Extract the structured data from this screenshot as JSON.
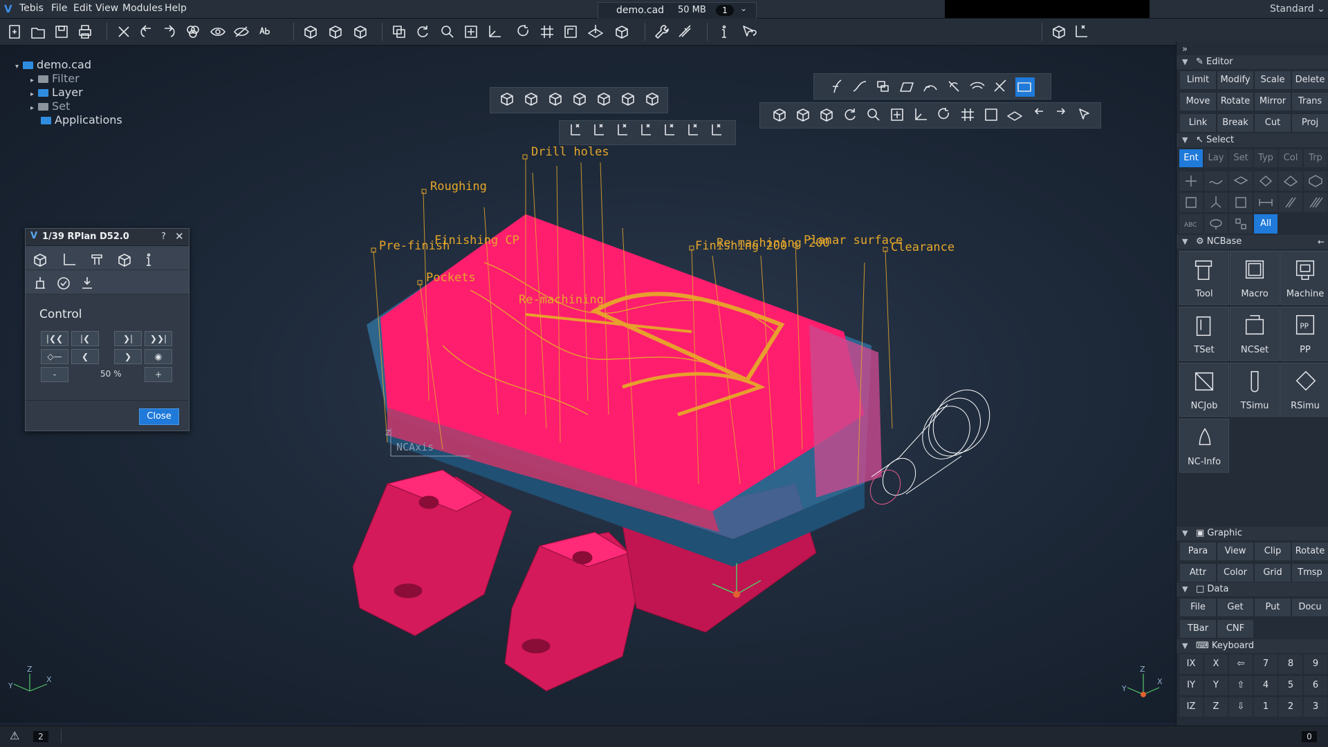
{
  "app": {
    "name": "Tebis",
    "document": "demo.cad",
    "memory": "50 MB",
    "doc_count": "1",
    "workspace": "Standard"
  },
  "menu": [
    "File",
    "Edit",
    "View",
    "Modules",
    "Help"
  ],
  "tree": {
    "root": "demo.cad",
    "items": [
      {
        "label": "Filter",
        "expandable": true
      },
      {
        "label": "Layer",
        "expandable": true
      },
      {
        "label": "Set",
        "expandable": true
      },
      {
        "label": "Applications",
        "expandable": false
      }
    ]
  },
  "viewport_labels": [
    "Drill holes",
    "Roughing",
    "Finishing CP",
    "Pre-finish",
    "Pockets",
    "Re-machining",
    "Finishing 200",
    "Re-machining 200",
    "Planar surface",
    "Clearance",
    "NCAxis"
  ],
  "dialog": {
    "title": "1/39 RPlan D52.0",
    "help": "?",
    "section": "Control",
    "speed": "50 %",
    "minus": "-",
    "plus": "+",
    "close": "Close"
  },
  "panel": {
    "editor": {
      "title": "Editor",
      "buttons": [
        "Limit",
        "Modify",
        "Scale",
        "Delete",
        "Move",
        "Rotate",
        "Mirror",
        "Trans",
        "Link",
        "Break",
        "Cut",
        "Proj"
      ]
    },
    "select": {
      "title": "Select",
      "tabs": [
        "Ent",
        "Lay",
        "Set",
        "Typ",
        "Col",
        "Trp"
      ],
      "all": "All"
    },
    "ncbase": {
      "title": "NCBase",
      "tiles": [
        "Tool",
        "Macro",
        "Machine",
        "TSet",
        "NCSet",
        "PP",
        "NCJob",
        "TSimu",
        "RSimu",
        "NC-Info"
      ]
    },
    "graphic": {
      "title": "Graphic",
      "buttons": [
        "Para",
        "View",
        "Clip",
        "Rotate",
        "Attr",
        "Color",
        "Grid",
        "Tmsp"
      ]
    },
    "data": {
      "title": "Data",
      "buttons": [
        "File",
        "Get",
        "Put",
        "Docu",
        "TBar",
        "CNF"
      ]
    },
    "keyboard": {
      "title": "Keyboard",
      "keys": [
        [
          "IX",
          "X",
          "⇦",
          "7",
          "8",
          "9"
        ],
        [
          "IY",
          "Y",
          "⇧",
          "4",
          "5",
          "6"
        ],
        [
          "IZ",
          "Z",
          "⇩",
          "1",
          "2",
          "3"
        ]
      ]
    }
  },
  "status": {
    "left_count": "2",
    "right_count": "0"
  },
  "colors": {
    "accent": "#1f7ad9",
    "part": "#ff1e6e",
    "toolpath": "#e6a72a",
    "background": "#1e2a3a"
  }
}
